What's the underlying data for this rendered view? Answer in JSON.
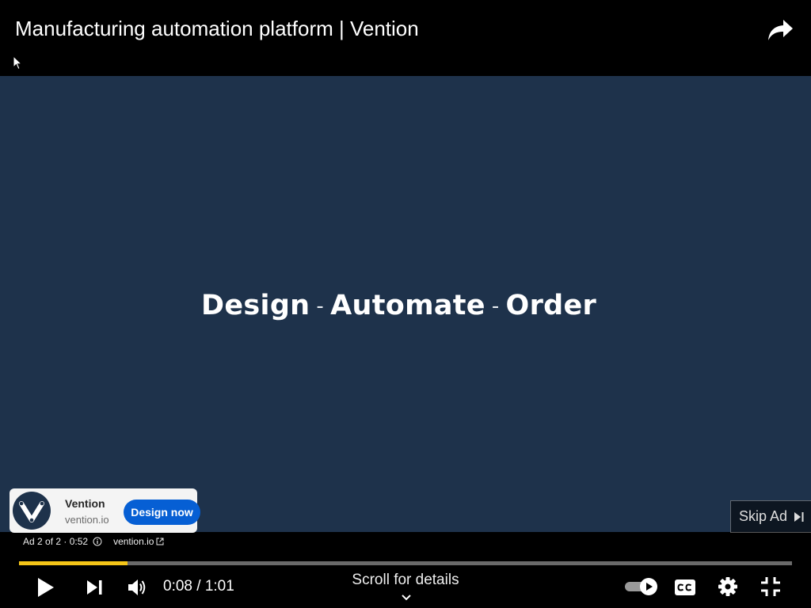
{
  "video": {
    "title": "Manufacturing automation platform | Vention",
    "tagline": {
      "word1": "Design",
      "sep": "-",
      "word2": "Automate",
      "word3": "Order"
    }
  },
  "ad_card": {
    "advertiser": "Vention",
    "domain": "vention.io",
    "cta_label": "Design now"
  },
  "skip": {
    "label": "Skip Ad"
  },
  "ad_info": {
    "position_text": "Ad 2 of 2 · 0:52",
    "link_text": "vention.io"
  },
  "player": {
    "current_time": "0:08",
    "time_separator": "/",
    "duration": "1:01",
    "time_display": "0:08 / 1:01",
    "scroll_hint": "Scroll for details",
    "progress_fraction": 0.14
  },
  "colors": {
    "video_bg": "#1e324b",
    "progress_fill": "#f5c518",
    "cta_blue": "#065fd4"
  },
  "icons": {
    "share": "share-arrow-icon",
    "play": "play-icon",
    "next": "skip-next-icon",
    "volume": "volume-icon",
    "autoplay": "autoplay-toggle-icon",
    "captions": "closed-captions-icon",
    "settings": "gear-icon",
    "exit_fullscreen": "exit-fullscreen-icon"
  }
}
